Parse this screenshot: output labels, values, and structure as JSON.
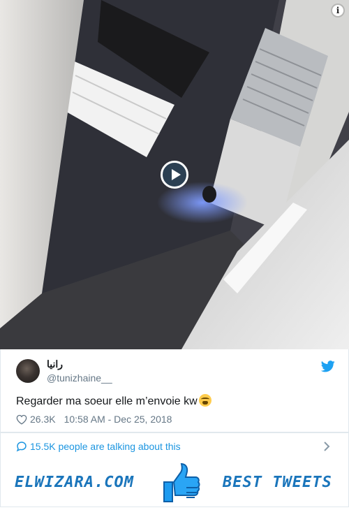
{
  "video": {
    "colors": {
      "wall_light": "#d9d8d6",
      "floor": "#3a3a3e",
      "accent_blue": "#6f8ff0"
    }
  },
  "tweet": {
    "display_name": "رانيا",
    "handle": "@tunizhaine__",
    "text": "Regarder ma soeur elle m’envoie kw",
    "emoji_icon": "loudly-crying-face-emoji",
    "likes": "26.3K",
    "timestamp": "10:58 AM - Dec 25, 2018"
  },
  "conversation": {
    "label": "15.5K people are talking about this"
  },
  "banner": {
    "left_text": "ELWIZARA.COM",
    "right_text": "BEST TWEETS",
    "icon": "thumbs-up-icon"
  },
  "colors": {
    "twitter_blue": "#1da1f2",
    "link_blue": "#1b95e0",
    "banner_blue": "#1a75bb",
    "muted": "#657786"
  }
}
